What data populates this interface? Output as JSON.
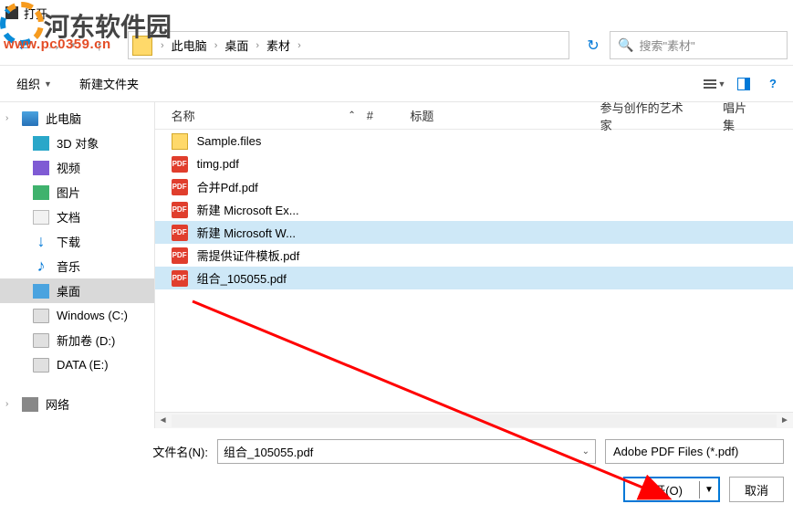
{
  "window": {
    "title": "打开"
  },
  "watermark": {
    "site_name": "河东软件园",
    "url": "www.pc0359.cn"
  },
  "nav": {
    "breadcrumb": [
      "此电脑",
      "桌面",
      "素材"
    ],
    "search_placeholder": "搜索\"素材\""
  },
  "toolbar": {
    "organize": "组织",
    "new_folder": "新建文件夹"
  },
  "sidebar": {
    "items": [
      {
        "label": "此电脑",
        "icon": "pc",
        "root": true
      },
      {
        "label": "3D 对象",
        "icon": "cube"
      },
      {
        "label": "视频",
        "icon": "vid"
      },
      {
        "label": "图片",
        "icon": "img"
      },
      {
        "label": "文档",
        "icon": "doc"
      },
      {
        "label": "下载",
        "icon": "dl"
      },
      {
        "label": "音乐",
        "icon": "music"
      },
      {
        "label": "桌面",
        "icon": "desk",
        "selected": true
      },
      {
        "label": "Windows (C:)",
        "icon": "drive"
      },
      {
        "label": "新加卷 (D:)",
        "icon": "drive"
      },
      {
        "label": "DATA (E:)",
        "icon": "drive"
      },
      {
        "label": "网络",
        "icon": "net",
        "root": true
      }
    ]
  },
  "columns": {
    "name": "名称",
    "num": "#",
    "title": "标题",
    "artists": "参与创作的艺术家",
    "album": "唱片集"
  },
  "files": [
    {
      "name": "Sample.files",
      "type": "folder"
    },
    {
      "name": "timg.pdf",
      "type": "pdf"
    },
    {
      "name": "合并Pdf.pdf",
      "type": "pdf"
    },
    {
      "name": "新建 Microsoft Ex...",
      "type": "pdf"
    },
    {
      "name": "新建 Microsoft W...",
      "type": "pdf",
      "hl": true
    },
    {
      "name": "需提供证件模板.pdf",
      "type": "pdf"
    },
    {
      "name": "组合_105055.pdf",
      "type": "pdf",
      "sel": true
    }
  ],
  "footer": {
    "filename_label": "文件名(N):",
    "filename_value": "组合_105055.pdf",
    "filter": "Adobe PDF Files (*.pdf)",
    "open": "打开(O)",
    "cancel": "取消"
  },
  "pdf_badge": "PDF"
}
